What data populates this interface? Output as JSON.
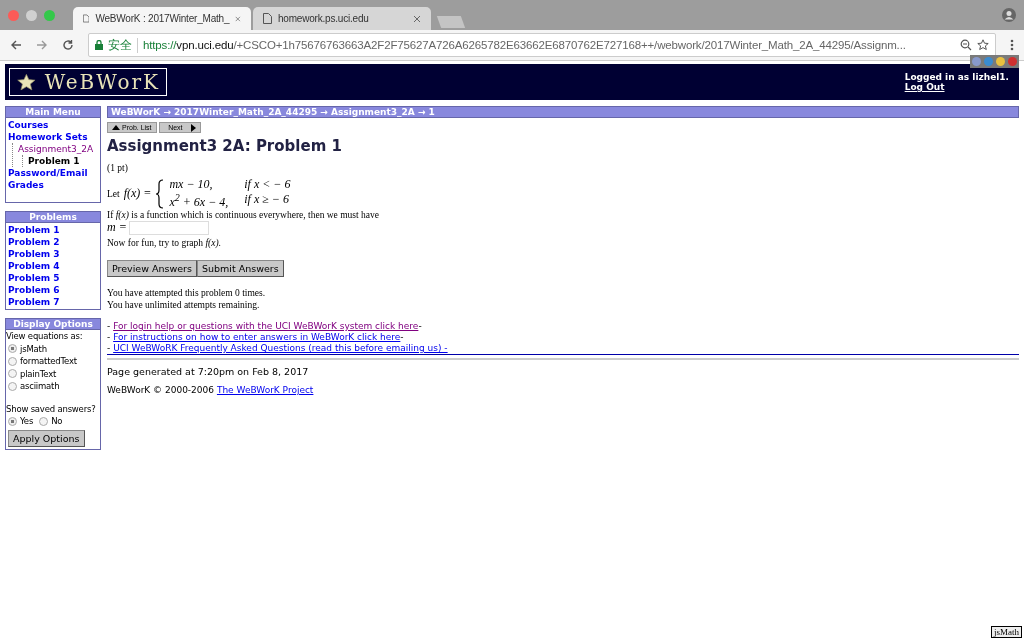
{
  "browser": {
    "tabs": [
      {
        "title": "WeBWorK : 2017Winter_Math_",
        "selected": true
      },
      {
        "title": "homework.ps.uci.edu",
        "selected": false
      }
    ],
    "address": {
      "secure_label": "安全",
      "scheme": "https://",
      "host": "vpn.uci.edu",
      "path": "/+CSCO+1h75676763663A2F2F75627A726A6265782E63662E6870762E727168++/webwork/2017Winter_Math_2A_44295/Assignm..."
    }
  },
  "header": {
    "logo": "WeBWorK",
    "logged_in": "Logged in as lizhel1.",
    "logout": "Log Out"
  },
  "main_menu": {
    "title": "Main Menu",
    "items": [
      {
        "label": "Courses",
        "kind": "link"
      },
      {
        "label": "Homework Sets",
        "kind": "link",
        "children": [
          {
            "label": "Assignment3_2A",
            "kind": "visited",
            "children": [
              {
                "label": "Problem 1",
                "kind": "current"
              }
            ]
          }
        ]
      },
      {
        "label": "Password/Email",
        "kind": "link"
      },
      {
        "label": "Grades",
        "kind": "link"
      }
    ]
  },
  "problems": {
    "title": "Problems",
    "items": [
      "Problem 1",
      "Problem 2",
      "Problem 3",
      "Problem 4",
      "Problem 5",
      "Problem 6",
      "Problem 7"
    ]
  },
  "display_options": {
    "title": "Display Options",
    "view_label": "View equations as:",
    "modes": [
      {
        "label": "jsMath",
        "selected": true
      },
      {
        "label": "formattedText",
        "selected": false
      },
      {
        "label": "plainText",
        "selected": false
      },
      {
        "label": "asciimath",
        "selected": false
      }
    ],
    "saved_label": "Show saved answers?",
    "saved": [
      {
        "label": "Yes",
        "selected": true
      },
      {
        "label": "No",
        "selected": false
      }
    ],
    "apply": "Apply Options"
  },
  "breadcrumb": "WeBWorK → 2017Winter_Math_2A_44295 → Assignment3_2A → 1",
  "nav": {
    "prev": "Prob. List",
    "next": "Next"
  },
  "title": "Assignment3 2A: Problem 1",
  "problem": {
    "points": "(1 pt)",
    "let": "Let",
    "lhs": "f(x) =",
    "pieces": [
      {
        "expr": "mx − 10,",
        "cond": "if x < − 6"
      },
      {
        "expr": "x$^{2}$ + 6x − 4,",
        "cond": "if x ≥ − 6"
      }
    ],
    "question": "If *f(x)* is a function which is continuous everywhere, then we must have",
    "answer_label": "m =",
    "graph": "Now for fun, try to graph *f(x)*."
  },
  "buttons": [
    "Preview Answers",
    "Submit Answers"
  ],
  "attempts": [
    "You have attempted this problem 0 times.",
    "You have unlimited attempts remaining."
  ],
  "links": [
    {
      "lead": "-",
      "text": "For login help or questions with the UCI WeBWorK system click here",
      "trail": "-",
      "visited": true
    },
    {
      "lead": "-",
      "text": "For instructions on how to enter answers in WeBWorK click here",
      "trail": "-",
      "visited": false
    },
    {
      "lead": "-",
      "text": "UCI WeBWoRK Frequently Asked Questions (read this before emailing us) -",
      "visited": false
    }
  ],
  "generated": "Page generated at 7:20pm on Feb 8, 2017",
  "copyright": "WeBWorK © 2000-2006",
  "project_link": "The WeBWorK Project",
  "badge": "jsMath"
}
